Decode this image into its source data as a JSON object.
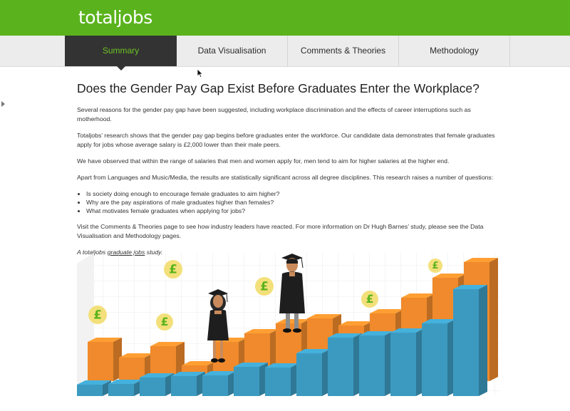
{
  "header": {
    "logo_text": "totaljobs",
    "brand_color": "#5ab31c"
  },
  "nav": {
    "tabs": [
      {
        "label": "Summary",
        "active": true
      },
      {
        "label": "Data Visualisation",
        "active": false
      },
      {
        "label": "Comments & Theories",
        "active": false
      },
      {
        "label": "Methodology",
        "active": false
      }
    ],
    "active_color": "#6cc223"
  },
  "article": {
    "title": "Does the Gender Pay Gap Exist Before Graduates Enter the Workplace?",
    "paragraphs": [
      "Several reasons for the gender pay gap have been suggested, including workplace discrimination and the effects of career interruptions such as motherhood.",
      "Totaljobs’ research shows that the gender pay gap begins before graduates enter the workforce. Our candidate data demonstrates that female graduates apply for jobs whose average salary is £2,000 lower than their male peers.",
      "We have observed that within the range of salaries that men and women apply for, men tend to aim for higher salaries at the higher end.",
      "Apart from Languages and Music/Media, the results are statistically significant across all degree disciplines. This research raises a number of questions:"
    ],
    "questions": [
      "Is society doing enough to encourage female graduates to aim higher?",
      "Why are the pay aspirations of male graduates higher than females?",
      "What motivates female graduates when applying for jobs?"
    ],
    "closing": "Visit the Comments & Theories page to see how industry leaders have reacted. For more information on Dr Hugh Barnes’ study, please see the Data Visualisation and Methodology pages.",
    "credit_prefix": "A totaljobs ",
    "credit_link": "graduate jobs",
    "credit_suffix": " study."
  },
  "illustration": {
    "icons": [
      "pound-coin-icon",
      "female-graduate-figure",
      "male-graduate-figure"
    ],
    "colors": {
      "orange": "#f08a2c",
      "blue": "#3c9ac0",
      "coin": "#f3e07a",
      "coin_symbol": "#5ab31c"
    }
  }
}
